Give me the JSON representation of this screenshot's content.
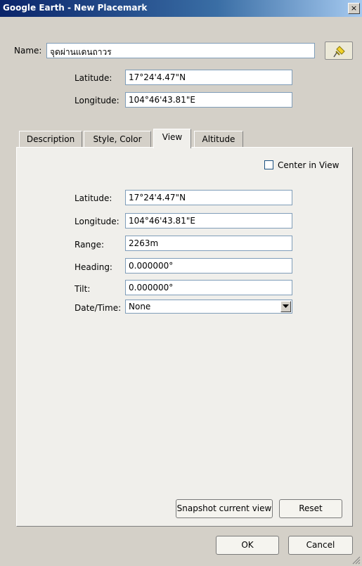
{
  "window": {
    "title": "Google Earth - New Placemark",
    "close_glyph": "×"
  },
  "name": {
    "label": "Name:",
    "value": "จุดผ่านแดนถาวร"
  },
  "top": {
    "latitude_label": "Latitude:",
    "latitude_value": "17°24'4.47\"N",
    "longitude_label": "Longitude:",
    "longitude_value": "104°46'43.81\"E"
  },
  "tabs": [
    {
      "label": "Description"
    },
    {
      "label": "Style, Color"
    },
    {
      "label": "View"
    },
    {
      "label": "Altitude"
    }
  ],
  "view": {
    "center_in_view_label": "Center in View",
    "center_in_view_checked": false,
    "latitude_label": "Latitude:",
    "latitude_value": "17°24'4.47\"N",
    "longitude_label": "Longitude:",
    "longitude_value": "104°46'43.81\"E",
    "range_label": "Range:",
    "range_value": "2263m",
    "heading_label": "Heading:",
    "heading_value": "0.000000°",
    "tilt_label": "Tilt:",
    "tilt_value": "0.000000°",
    "datetime_label": "Date/Time:",
    "datetime_value": "None",
    "snapshot_label": "Snapshot current view",
    "reset_label": "Reset"
  },
  "footer": {
    "ok_label": "OK",
    "cancel_label": "Cancel"
  },
  "icons": {
    "pin": "pushpin-icon",
    "dropdown": "chevron-down-icon",
    "grip": "resize-grip-icon"
  }
}
